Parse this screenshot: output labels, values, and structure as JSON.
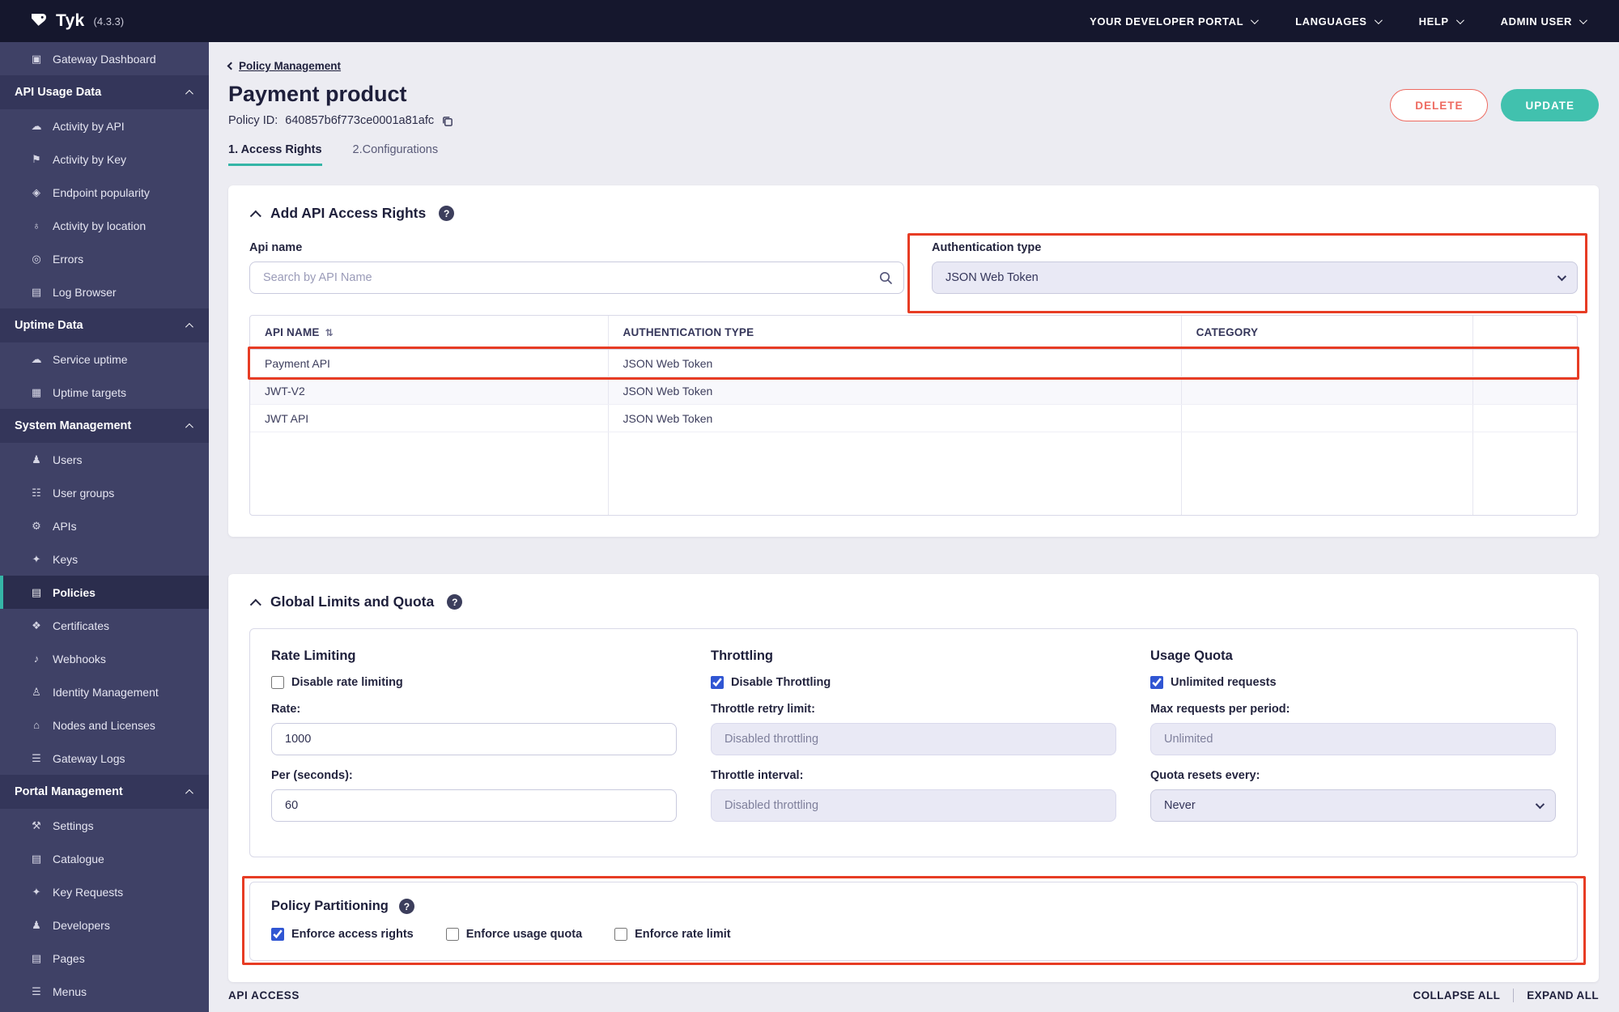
{
  "topbar": {
    "logo_text": "Tyk",
    "version": "(4.3.3)",
    "menus": [
      {
        "id": "developer-portal",
        "label": "YOUR DEVELOPER PORTAL"
      },
      {
        "id": "languages",
        "label": "LANGUAGES"
      },
      {
        "id": "help",
        "label": "HELP"
      },
      {
        "id": "admin-user",
        "label": "ADMIN USER"
      }
    ]
  },
  "sidebar": {
    "items": [
      {
        "type": "link",
        "id": "gateway-dashboard",
        "label": "Gateway Dashboard",
        "glyph": "▣"
      },
      {
        "type": "section",
        "id": "api-usage-data",
        "label": "API Usage Data"
      },
      {
        "type": "link",
        "id": "activity-by-api",
        "label": "Activity by API",
        "glyph": "☁"
      },
      {
        "type": "link",
        "id": "activity-by-key",
        "label": "Activity by Key",
        "glyph": "⚑"
      },
      {
        "type": "link",
        "id": "endpoint-popularity",
        "label": "Endpoint popularity",
        "glyph": "◈"
      },
      {
        "type": "link",
        "id": "activity-by-location",
        "label": "Activity by location",
        "glyph": "♁"
      },
      {
        "type": "link",
        "id": "errors",
        "label": "Errors",
        "glyph": "◎"
      },
      {
        "type": "link",
        "id": "log-browser",
        "label": "Log Browser",
        "glyph": "▤"
      },
      {
        "type": "section",
        "id": "uptime-data",
        "label": "Uptime Data"
      },
      {
        "type": "link",
        "id": "service-uptime",
        "label": "Service uptime",
        "glyph": "☁"
      },
      {
        "type": "link",
        "id": "uptime-targets",
        "label": "Uptime targets",
        "glyph": "▦"
      },
      {
        "type": "section",
        "id": "system-management",
        "label": "System Management"
      },
      {
        "type": "link",
        "id": "users",
        "label": "Users",
        "glyph": "♟"
      },
      {
        "type": "link",
        "id": "user-groups",
        "label": "User groups",
        "glyph": "☷"
      },
      {
        "type": "link",
        "id": "apis",
        "label": "APIs",
        "glyph": "⚙"
      },
      {
        "type": "link",
        "id": "keys",
        "label": "Keys",
        "glyph": "✦"
      },
      {
        "type": "link",
        "id": "policies",
        "label": "Policies",
        "glyph": "▤",
        "active": true
      },
      {
        "type": "link",
        "id": "certificates",
        "label": "Certificates",
        "glyph": "❖"
      },
      {
        "type": "link",
        "id": "webhooks",
        "label": "Webhooks",
        "glyph": "♪"
      },
      {
        "type": "link",
        "id": "identity-management",
        "label": "Identity Management",
        "glyph": "♙"
      },
      {
        "type": "link",
        "id": "nodes-and-licenses",
        "label": "Nodes and Licenses",
        "glyph": "⌂"
      },
      {
        "type": "link",
        "id": "gateway-logs",
        "label": "Gateway Logs",
        "glyph": "☰"
      },
      {
        "type": "section",
        "id": "portal-management",
        "label": "Portal Management"
      },
      {
        "type": "link",
        "id": "settings",
        "label": "Settings",
        "glyph": "⚒"
      },
      {
        "type": "link",
        "id": "catalogue",
        "label": "Catalogue",
        "glyph": "▤"
      },
      {
        "type": "link",
        "id": "key-requests",
        "label": "Key Requests",
        "glyph": "✦"
      },
      {
        "type": "link",
        "id": "developers",
        "label": "Developers",
        "glyph": "♟"
      },
      {
        "type": "link",
        "id": "pages",
        "label": "Pages",
        "glyph": "▤"
      },
      {
        "type": "link",
        "id": "menus",
        "label": "Menus",
        "glyph": "☰"
      }
    ]
  },
  "page": {
    "breadcrumb": "Policy Management",
    "title": "Payment product",
    "policy_id_label": "Policy ID:",
    "policy_id": "640857b6f773ce0001a81afc",
    "delete_label": "DELETE",
    "update_label": "UPDATE",
    "tabs": [
      {
        "label": "1. Access Rights",
        "active": true
      },
      {
        "label": "2.Configurations",
        "active": false
      }
    ]
  },
  "access_rights": {
    "title": "Add API Access Rights",
    "help_glyph": "?",
    "api_name_label": "Api name",
    "search_placeholder": "Search by API Name",
    "auth_type_label": "Authentication type",
    "auth_type_value": "JSON Web Token",
    "table": {
      "sort_glyph": "⇅",
      "headers": [
        "API NAME",
        "AUTHENTICATION TYPE",
        "CATEGORY"
      ],
      "rows": [
        {
          "api_name": "Payment API",
          "auth_type": "JSON Web Token",
          "category": "",
          "annotated": true
        },
        {
          "api_name": "JWT-V2",
          "auth_type": "JSON Web Token",
          "category": "",
          "annotated": false
        },
        {
          "api_name": "JWT API",
          "auth_type": "JSON Web Token",
          "category": "",
          "annotated": false
        }
      ]
    }
  },
  "limits": {
    "title": "Global Limits and Quota",
    "help_glyph": "?",
    "rate_limiting": {
      "title": "Rate Limiting",
      "checkbox_label": "Disable rate limiting",
      "checked": false,
      "rate_label": "Rate:",
      "rate_value": "1000",
      "per_label": "Per (seconds):",
      "per_value": "60"
    },
    "throttling": {
      "title": "Throttling",
      "checkbox_label": "Disable Throttling",
      "checked": true,
      "retry_label": "Throttle retry limit:",
      "retry_value": "Disabled throttling",
      "interval_label": "Throttle interval:",
      "interval_value": "Disabled throttling"
    },
    "usage_quota": {
      "title": "Usage Quota",
      "checkbox_label": "Unlimited requests",
      "checked": true,
      "max_label": "Max requests per period:",
      "max_value": "Unlimited",
      "resets_label": "Quota resets every:",
      "resets_value": "Never"
    }
  },
  "partitioning": {
    "title": "Policy Partitioning",
    "help_glyph": "?",
    "options": [
      {
        "label": "Enforce access rights",
        "checked": true
      },
      {
        "label": "Enforce usage quota",
        "checked": false
      },
      {
        "label": "Enforce rate limit",
        "checked": false
      }
    ]
  },
  "footer": {
    "left_label": "API ACCESS",
    "collapse_label": "COLLAPSE ALL",
    "expand_label": "EXPAND ALL"
  },
  "colors": {
    "accent_teal": "#35b5a7",
    "delete_red": "#ee6a60",
    "annotation_red": "#e73c24",
    "checkbox_blue": "#3056d3",
    "topbar_bg": "#15172d",
    "sidebar_bg": "#3f4166"
  }
}
